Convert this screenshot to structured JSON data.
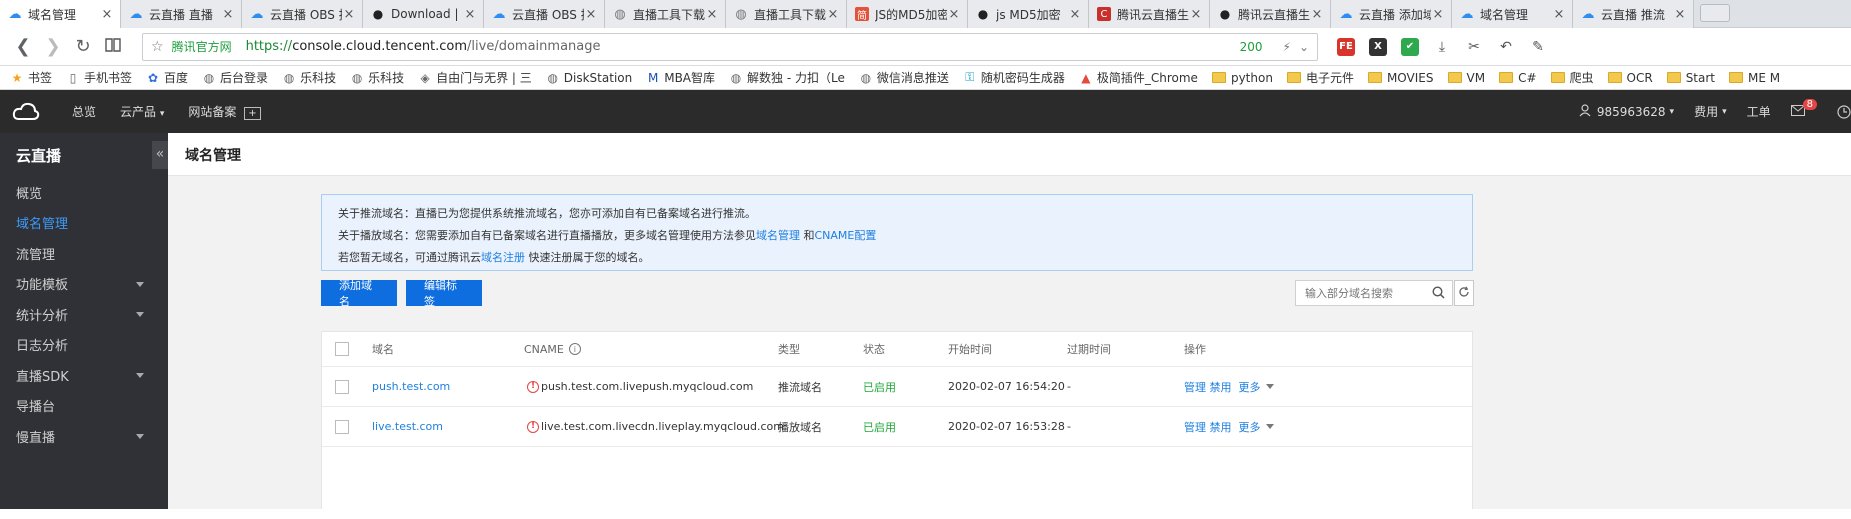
{
  "browser": {
    "tabs": [
      {
        "title": "域名管理",
        "icon": "tencent-cloud-icon",
        "color": "#2f8cf0",
        "active": true
      },
      {
        "title": "云直播 直播",
        "icon": "tencent-cloud-icon",
        "color": "#2f8cf0"
      },
      {
        "title": "云直播 OBS 推",
        "icon": "tencent-cloud-icon",
        "color": "#2f8cf0"
      },
      {
        "title": "Download |",
        "icon": "github-icon",
        "color": "#222222"
      },
      {
        "title": "云直播 OBS 推",
        "icon": "tencent-cloud-icon",
        "color": "#2f8cf0"
      },
      {
        "title": "直播工具下载",
        "icon": "globe-icon",
        "color": "#777777"
      },
      {
        "title": "直播工具下载",
        "icon": "globe-icon",
        "color": "#777777"
      },
      {
        "title": "JS的MD5加密",
        "icon": "jianshu-icon",
        "color": "#e3533c"
      },
      {
        "title": "js MD5加密",
        "icon": "github-icon",
        "color": "#222222"
      },
      {
        "title": "腾讯云直播生",
        "icon": "csdn-icon",
        "color": "#c9302c"
      },
      {
        "title": "腾讯云直播生",
        "icon": "github-icon",
        "color": "#222222"
      },
      {
        "title": "云直播 添加域",
        "icon": "tencent-cloud-icon",
        "color": "#2f8cf0"
      },
      {
        "title": "域名管理",
        "icon": "tencent-cloud-icon",
        "color": "#2f8cf0"
      },
      {
        "title": "云直播 推流",
        "icon": "tencent-cloud-icon",
        "color": "#2f8cf0"
      }
    ],
    "address": {
      "site_badge": "腾讯官方网",
      "url_https": "https://",
      "url_host": "console.cloud.tencent.com",
      "url_path": "/live/domainmanage",
      "zoom": "200"
    },
    "extensions": [
      {
        "name": "fe-extension-icon",
        "label": "FE",
        "color": "#d9342b"
      },
      {
        "name": "x-extension-icon",
        "label": "X",
        "color": "#333333"
      },
      {
        "name": "shield-extension-icon",
        "label": "✔",
        "color": "#2fa94e"
      },
      {
        "name": "download-icon",
        "label": "⤓",
        "color": "#ffffff"
      },
      {
        "name": "cut-icon",
        "label": "✂",
        "color": "#ffffff"
      },
      {
        "name": "undo-icon",
        "label": "↶",
        "color": "#ffffff"
      },
      {
        "name": "pen-icon",
        "label": "✎",
        "color": "#ffffff"
      }
    ],
    "bookmarks": [
      {
        "label": "书签",
        "icon": "star-icon",
        "folder": false
      },
      {
        "label": "手机书签",
        "icon": "phone-icon",
        "folder": false
      },
      {
        "label": "百度",
        "icon": "baidu-icon",
        "folder": false
      },
      {
        "label": "后台登录",
        "icon": "globe-icon",
        "folder": false
      },
      {
        "label": "乐科技",
        "icon": "globe-icon",
        "folder": false
      },
      {
        "label": "乐科技",
        "icon": "globe-icon",
        "folder": false
      },
      {
        "label": "自由门与无界 | 三",
        "icon": "diamond-icon",
        "folder": false
      },
      {
        "label": "DiskStation",
        "icon": "globe-icon",
        "folder": false
      },
      {
        "label": "MBA智库",
        "icon": "mba-icon",
        "folder": false
      },
      {
        "label": "解数独 - 力扣（Le",
        "icon": "globe-icon",
        "folder": false
      },
      {
        "label": "微信消息推送",
        "icon": "globe-icon",
        "folder": false
      },
      {
        "label": "随机密码生成器",
        "icon": "key-icon",
        "folder": false
      },
      {
        "label": "极简插件_Chrome",
        "icon": "plugin-icon",
        "folder": false
      },
      {
        "label": "python",
        "icon": "folder-icon",
        "folder": true
      },
      {
        "label": "电子元件",
        "icon": "folder-icon",
        "folder": true
      },
      {
        "label": "MOVIES",
        "icon": "folder-icon",
        "folder": true
      },
      {
        "label": "VM",
        "icon": "folder-icon",
        "folder": true
      },
      {
        "label": "C#",
        "icon": "folder-icon",
        "folder": true
      },
      {
        "label": "爬虫",
        "icon": "folder-icon",
        "folder": true
      },
      {
        "label": "OCR",
        "icon": "folder-icon",
        "folder": true
      },
      {
        "label": "Start",
        "icon": "folder-icon",
        "folder": true
      },
      {
        "label": "ME M",
        "icon": "folder-icon",
        "folder": true
      }
    ]
  },
  "console": {
    "top_nav": {
      "overview": "总览",
      "products": "云产品",
      "icp": "网站备案",
      "account": "985963628",
      "billing": "费用",
      "ticket": "工单",
      "mail_count": "8"
    },
    "sidebar": {
      "title": "云直播",
      "items": [
        {
          "label": "概览",
          "active": false,
          "has_caret": false
        },
        {
          "label": "域名管理",
          "active": true,
          "has_caret": false
        },
        {
          "label": "流管理",
          "active": false,
          "has_caret": false
        },
        {
          "label": "功能模板",
          "active": false,
          "has_caret": true
        },
        {
          "label": "统计分析",
          "active": false,
          "has_caret": true
        },
        {
          "label": "日志分析",
          "active": false,
          "has_caret": false
        },
        {
          "label": "直播SDK",
          "active": false,
          "has_caret": true
        },
        {
          "label": "导播台",
          "active": false,
          "has_caret": false
        },
        {
          "label": "慢直播",
          "active": false,
          "has_caret": true
        }
      ]
    },
    "page": {
      "title": "域名管理",
      "notice": {
        "line1": "关于推流域名：直播已为您提供系统推流域名，您亦可添加自有已备案域名进行推流。",
        "line2_prefix": "关于播放域名：您需要添加自有已备案域名进行直播播放，更多域名管理使用方法参见",
        "line2_link1": "域名管理",
        "line2_mid": " 和",
        "line2_link2": "CNAME配置",
        "line3_prefix": "若您暂无域名，可通过腾讯云",
        "line3_link": "域名注册",
        "line3_suffix": " 快速注册属于您的域名。"
      },
      "add_domain_button": "添加域名",
      "edit_tag_button": "编辑标签",
      "search_placeholder": "输入部分域名搜索",
      "table": {
        "headers": {
          "domain": "域名",
          "cname": "CNAME",
          "type": "类型",
          "status": "状态",
          "start_time": "开始时间",
          "expire_time": "过期时间",
          "actions": "操作"
        },
        "rows": [
          {
            "domain": "push.test.com",
            "cname": "push.test.com.livepush.myqcloud.com",
            "type": "推流域名",
            "status": "已启用",
            "start_time": "2020-02-07 16:54:20",
            "expire_time": "-",
            "action_manage": "管理",
            "action_disable": "禁用",
            "action_more": "更多"
          },
          {
            "domain": "live.test.com",
            "cname": "live.test.com.livecdn.liveplay.myqcloud.com",
            "type": "播放域名",
            "status": "已启用",
            "start_time": "2020-02-07 16:53:28",
            "expire_time": "-",
            "action_manage": "管理",
            "action_disable": "禁用",
            "action_more": "更多"
          }
        ]
      }
    }
  }
}
